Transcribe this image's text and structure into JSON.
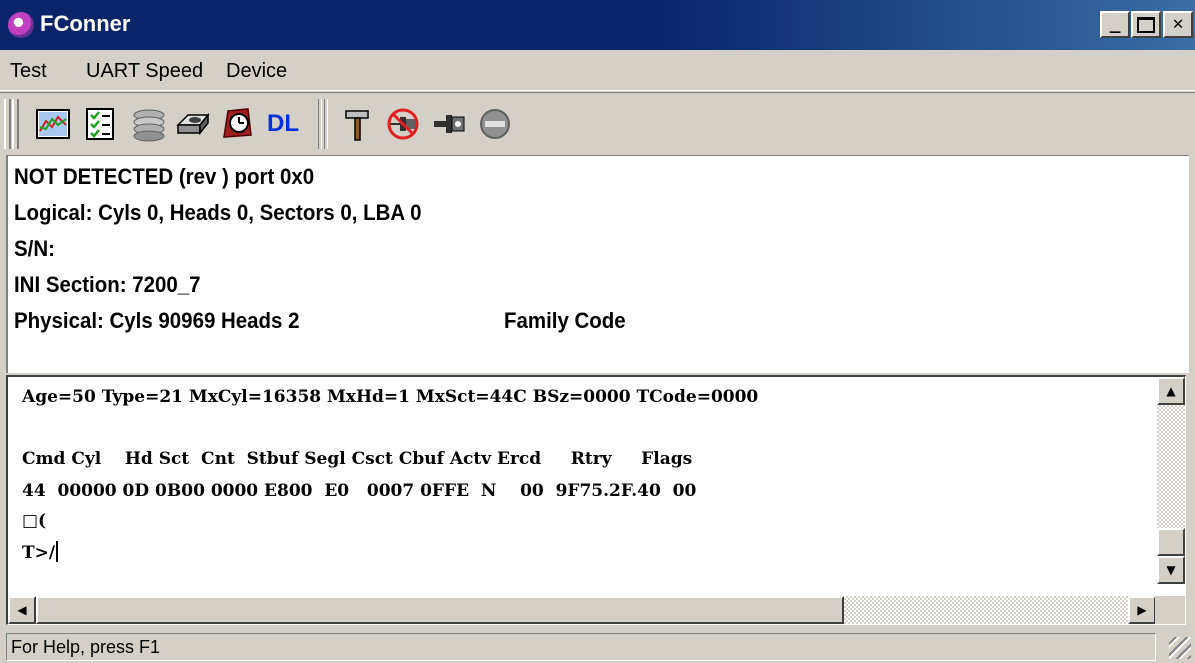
{
  "window": {
    "title": "FConner"
  },
  "menu": {
    "items": [
      "Test",
      "UART Speed",
      "Device"
    ]
  },
  "toolbar": {
    "buttons": [
      {
        "icon": "chart-icon"
      },
      {
        "icon": "checklist-icon"
      },
      {
        "icon": "disk-stack-icon"
      },
      {
        "icon": "drive-icon"
      },
      {
        "icon": "timer-icon"
      },
      {
        "icon": "dl-text",
        "label": "DL"
      },
      {
        "icon": "hammer-icon"
      },
      {
        "icon": "disconnect-icon"
      },
      {
        "icon": "connect-icon"
      },
      {
        "icon": "stop-icon"
      }
    ]
  },
  "info": {
    "line1": "NOT DETECTED (rev ) port 0x0",
    "line2": "Logical: Cyls 0, Heads 0, Sectors 0, LBA 0",
    "line3": "S/N:",
    "line4": "INI Section: 7200_7",
    "line5a": "Physical: Cyls 90969 Heads 2",
    "line5b": "Family Code"
  },
  "console": {
    "line1": "Age=50 Type=21 MxCyl=16358 MxHd=1 MxSct=44C BSz=0000 TCode=0000",
    "header": "Cmd Cyl    Hd Sct  Cnt  Stbuf Segl Csct Cbuf Actv Ercd     Rtry     Flags",
    "row": "44  00000 0D 0B00 0000 E800  E0   0007 0FFE  N    00  9F75.2F.40  00",
    "line4": "□(",
    "prompt": "T>/"
  },
  "status": {
    "text": "For Help, press F1"
  }
}
